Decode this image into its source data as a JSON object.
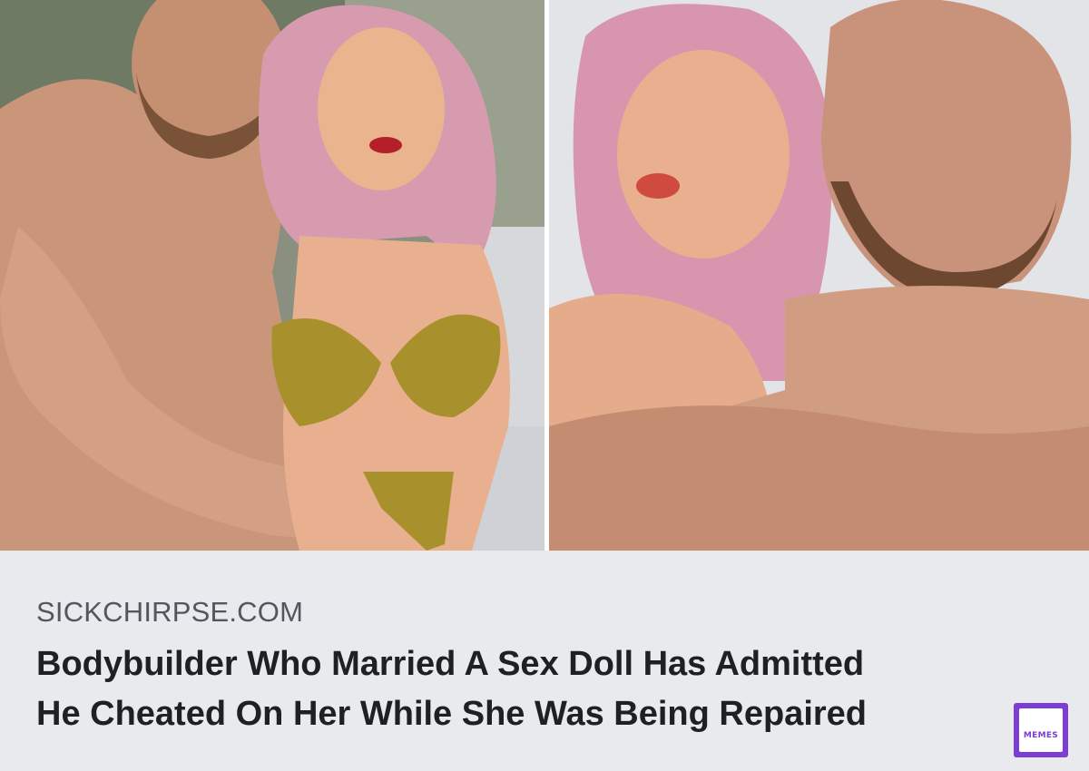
{
  "source": "SICKCHIRPSE.COM",
  "headline": {
    "line1": "Bodybuilder Who Married A Sex Doll Has Admitted",
    "line2": "He Cheated On Her While She Was Being Repaired"
  },
  "badge": {
    "text": "MEMES",
    "color": "#7b3dd6"
  },
  "icons": {
    "badge_icon": "memes-logo-icon"
  }
}
